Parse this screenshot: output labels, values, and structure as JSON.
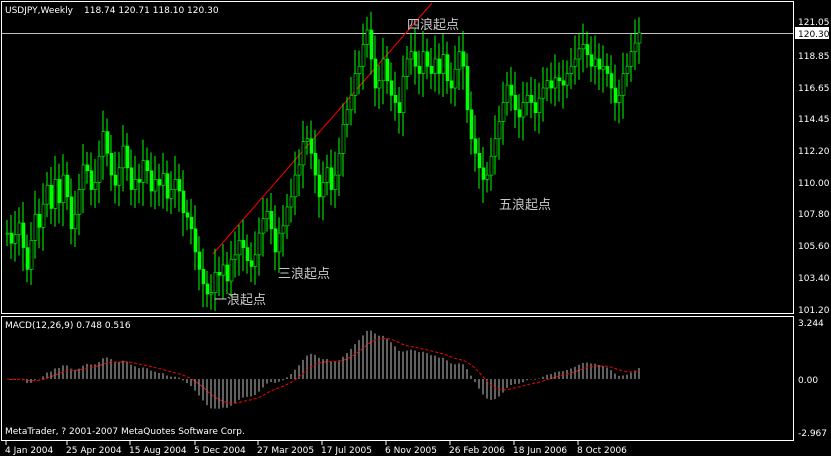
{
  "header": {
    "symbol_timeframe": "USDJPY,Weekly",
    "ohlc": "118.74 120.71 118.10 120.30"
  },
  "price_panel": {
    "current_price_label": "120.30",
    "y_ticks": [
      "121.05",
      "118.85",
      "116.65",
      "114.45",
      "112.20",
      "110.00",
      "107.80",
      "105.60",
      "103.40",
      "101.20"
    ],
    "annotations": [
      "一浪起点",
      "三浪起点",
      "四浪起点",
      "五浪起点"
    ],
    "colors": {
      "candle": "#00ff00",
      "trendline": "#ff0000",
      "current_line": "#c0c0c0",
      "frame": "#ffffff"
    }
  },
  "macd_panel": {
    "label": "MACD(12,26,9) 0.748 0.516",
    "y_ticks": [
      "3.244",
      "0.00",
      "-2.967"
    ],
    "colors": {
      "histogram": "#c0c0c0",
      "signal": "#ff0000"
    }
  },
  "x_axis": {
    "labels": [
      "4 Jan 2004",
      "25 Apr 2004",
      "15 Aug 2004",
      "5 Dec 2004",
      "27 Mar 2005",
      "17 Jul 2005",
      "6 Nov 2005",
      "26 Feb 2006",
      "18 Jun 2006",
      "8 Oct 2006"
    ]
  },
  "copyright": "MetaTrader, ? 2001-2007 MetaQuotes Software Corp.",
  "chart_data": {
    "type": "candlestick",
    "series": [
      {
        "close": [
          106.5,
          105.8,
          106.4,
          107.2,
          105.5,
          104.0,
          106.0,
          107.8,
          106.9,
          108.5,
          109.8,
          108.2,
          110.2,
          108.6,
          110.5,
          109.0,
          106.8,
          107.8,
          109.5,
          111.2,
          110.8,
          109.5,
          110.0,
          111.8,
          113.5,
          112.0,
          110.5,
          109.8,
          111.0,
          112.5,
          111.0,
          109.5,
          110.2,
          110.0,
          111.5,
          110.8,
          109.4,
          110.2,
          109.8,
          110.6,
          108.9,
          109.5,
          110.2,
          109.4,
          107.9,
          107.6,
          106.8,
          105.2,
          104.0,
          103.0,
          102.3,
          102.4,
          103.8,
          103.6,
          104.3,
          103.2,
          104.7,
          105.0,
          106.0,
          105.5,
          104.6,
          104.2,
          105.0,
          106.5,
          107.5,
          108.0,
          106.8,
          105.2,
          106.5,
          107.0,
          108.3,
          109.0,
          110.5,
          111.2,
          112.8,
          113.0,
          112.0,
          110.5,
          109.0,
          110.0,
          111.0,
          109.5,
          110.5,
          112.0,
          114.0,
          115.0,
          116.0,
          117.5,
          118.0,
          119.5,
          120.5,
          118.5,
          116.5,
          117.0,
          118.5,
          117.0,
          116.0,
          115.5,
          114.8,
          117.3,
          118.5,
          119.0,
          118.0,
          117.5,
          119.0,
          118.0,
          117.5,
          118.5,
          117.5,
          118.8,
          117.0,
          116.5,
          117.8,
          119.0,
          118.0,
          115.0,
          113.0,
          112.0,
          111.0,
          110.2,
          110.5,
          111.8,
          113.0,
          114.2,
          115.5,
          116.7,
          116.0,
          115.0,
          114.5,
          115.5,
          116.0,
          115.5,
          114.8,
          115.8,
          116.5,
          117.0,
          116.5,
          117.2,
          117.0,
          116.7,
          117.5,
          118.0,
          118.5,
          119.2,
          119.5,
          118.8,
          118.0,
          118.5,
          117.8,
          118.0,
          117.5,
          116.5,
          115.5,
          116.0,
          117.5,
          118.0,
          119.0,
          119.6,
          120.3
        ]
      }
    ],
    "ylim": [
      101.2,
      121.05
    ]
  }
}
